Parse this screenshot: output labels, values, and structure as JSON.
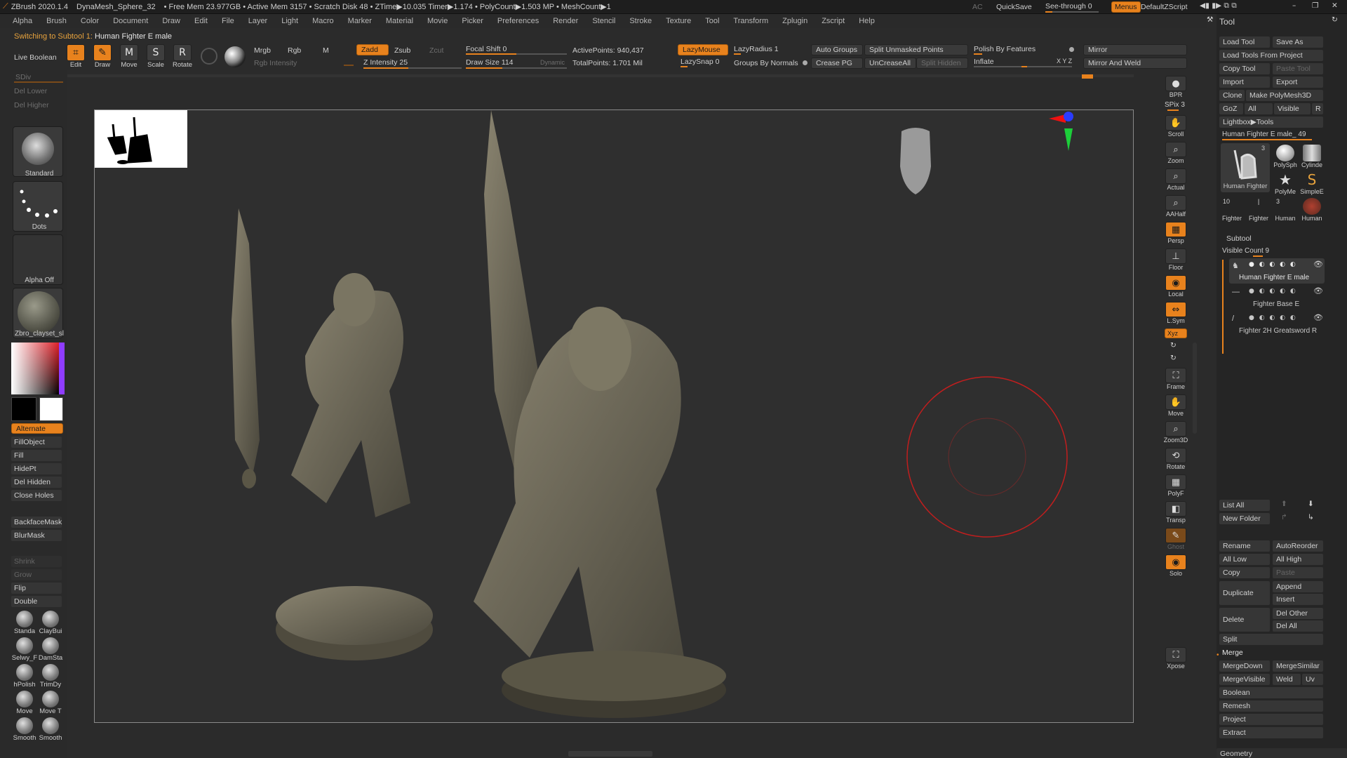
{
  "title_bar": {
    "segments": [
      "ZBrush 2020.1.4",
      "DynaMesh_Sphere_32",
      "• Free Mem 23.977GB • Active Mem 3157 • Scratch Disk 48 • ZTime▶10.035 Timer▶1.174 • PolyCount▶1.503 MP • MeshCount▶1"
    ],
    "ac": "AC",
    "quicksave": "QuickSave",
    "see_through": "See-through  0",
    "menus": "Menus",
    "default_zscript": "DefaultZScript"
  },
  "menu_bar": [
    "Alpha",
    "Brush",
    "Color",
    "Document",
    "Draw",
    "Edit",
    "File",
    "Layer",
    "Light",
    "Macro",
    "Marker",
    "Material",
    "Movie",
    "Picker",
    "Preferences",
    "Render",
    "Stencil",
    "Stroke",
    "Texture",
    "Tool",
    "Transform",
    "Zplugin",
    "Zscript",
    "Help"
  ],
  "status": {
    "prefix": "Switching to Subtool 1:",
    "name": "Human Fighter E male"
  },
  "top_shelf": {
    "live_boolean": "Live Boolean",
    "edit": "Edit",
    "draw": "Draw",
    "move": "Move",
    "scale": "Scale",
    "rotate": "Rotate",
    "mrgb": "Mrgb",
    "rgb": "Rgb",
    "m": "M",
    "rgb_intensity": "Rgb Intensity",
    "zadd": "Zadd",
    "zsub": "Zsub",
    "zcut": "Zcut",
    "z_intensity": "Z Intensity 25",
    "focal_shift": "Focal Shift 0",
    "draw_size": "Draw Size 114",
    "dynamic": "Dynamic",
    "active_points": "ActivePoints: 940,437",
    "total_points": "TotalPoints: 1.701 Mil",
    "lazymouse": "LazyMouse",
    "lazyradius": "LazyRadius 1",
    "lazysnap": "LazySnap 0",
    "auto_groups": "Auto Groups",
    "groups_by_normals": "Groups By Normals",
    "split_unmasked": "Split Unmasked Points",
    "crease_pg": "Crease PG",
    "uncrease_all": "UnCreaseAll",
    "split_hidden": "Split Hidden",
    "polish_by_features": "Polish By Features",
    "inflate": "Inflate",
    "mirror": "Mirror",
    "mirror_and_weld": "Mirror And Weld"
  },
  "left_panel": {
    "sdiv": "SDiv",
    "del_lower": "Del Lower",
    "del_higher": "Del Higher",
    "standard": "Standard",
    "dots": "Dots",
    "alpha_off": "Alpha Off",
    "material": "Zbro_clayset_sl",
    "alternate": "Alternate",
    "buttons": [
      "FillObject",
      "Fill",
      "HidePt",
      "Del Hidden",
      "Close Holes"
    ],
    "backface": "BackfaceMask",
    "blurmask": "BlurMask",
    "shrink": "Shrink",
    "grow": "Grow",
    "flip": "Flip",
    "double": "Double",
    "brushes": [
      "Standa",
      "ClayBui",
      "Selwy_F",
      "DamSta",
      "hPolish",
      "TrimDy",
      "Move",
      "Move T",
      "Smooth",
      "Smooth"
    ]
  },
  "right_shelf": [
    "BPR",
    "SPix 3",
    "Scroll",
    "Zoom",
    "Actual",
    "AAHalf",
    "Persp",
    "Floor",
    "Local",
    "L.Sym",
    "Xyz",
    "Frame",
    "Move",
    "Zoom3D",
    "Rotate",
    "PolyF",
    "Transp",
    "Ghost",
    "Solo",
    "Xpose"
  ],
  "tool_panel": {
    "title": "Tool",
    "load_tool": "Load Tool",
    "save_as": "Save As",
    "load_from_project": "Load Tools From Project",
    "copy_tool": "Copy Tool",
    "paste_tool": "Paste Tool",
    "import": "Import",
    "export": "Export",
    "clone": "Clone",
    "make_polymesh": "Make PolyMesh3D",
    "goz": "GoZ",
    "all": "All",
    "visible": "Visible",
    "r": "R",
    "lightbox_tools": "Lightbox▶Tools",
    "current_tool": "Human Fighter E male_ 49",
    "thumbs": [
      "Human Fighter",
      "PolySph",
      "Cylinde",
      "PolyMe",
      "SimpleE",
      "Fighter",
      "Fighter",
      "Human",
      "Human"
    ],
    "thumb_count_main": "3",
    "thumb_count_a": "10",
    "thumb_count_b": "3",
    "subtool": "Subtool",
    "visible_count": "Visible Count 9",
    "subtools": [
      "Human Fighter E male",
      "Fighter Base E",
      "Fighter 2H Greatsword R"
    ],
    "list_all": "List All",
    "new_folder": "New Folder",
    "rename": "Rename",
    "auto_reorder": "AutoReorder",
    "all_low": "All Low",
    "all_high": "All High",
    "copy": "Copy",
    "paste": "Paste",
    "duplicate": "Duplicate",
    "append": "Append",
    "insert": "Insert",
    "delete": "Delete",
    "del_other": "Del Other",
    "del_all": "Del All",
    "split": "Split",
    "merge": "Merge",
    "merge_down": "MergeDown",
    "merge_similar": "MergeSimilar",
    "merge_visible": "MergeVisible",
    "weld": "Weld",
    "uv": "Uv",
    "boolean": "Boolean",
    "remesh": "Remesh",
    "project": "Project",
    "extract": "Extract",
    "geometry": "Geometry"
  },
  "colors": {
    "accent": "#e8821d",
    "canvas_bg": "#2f2f2f",
    "model": "#6f6a57",
    "brush_ring": "#c01e1e"
  }
}
